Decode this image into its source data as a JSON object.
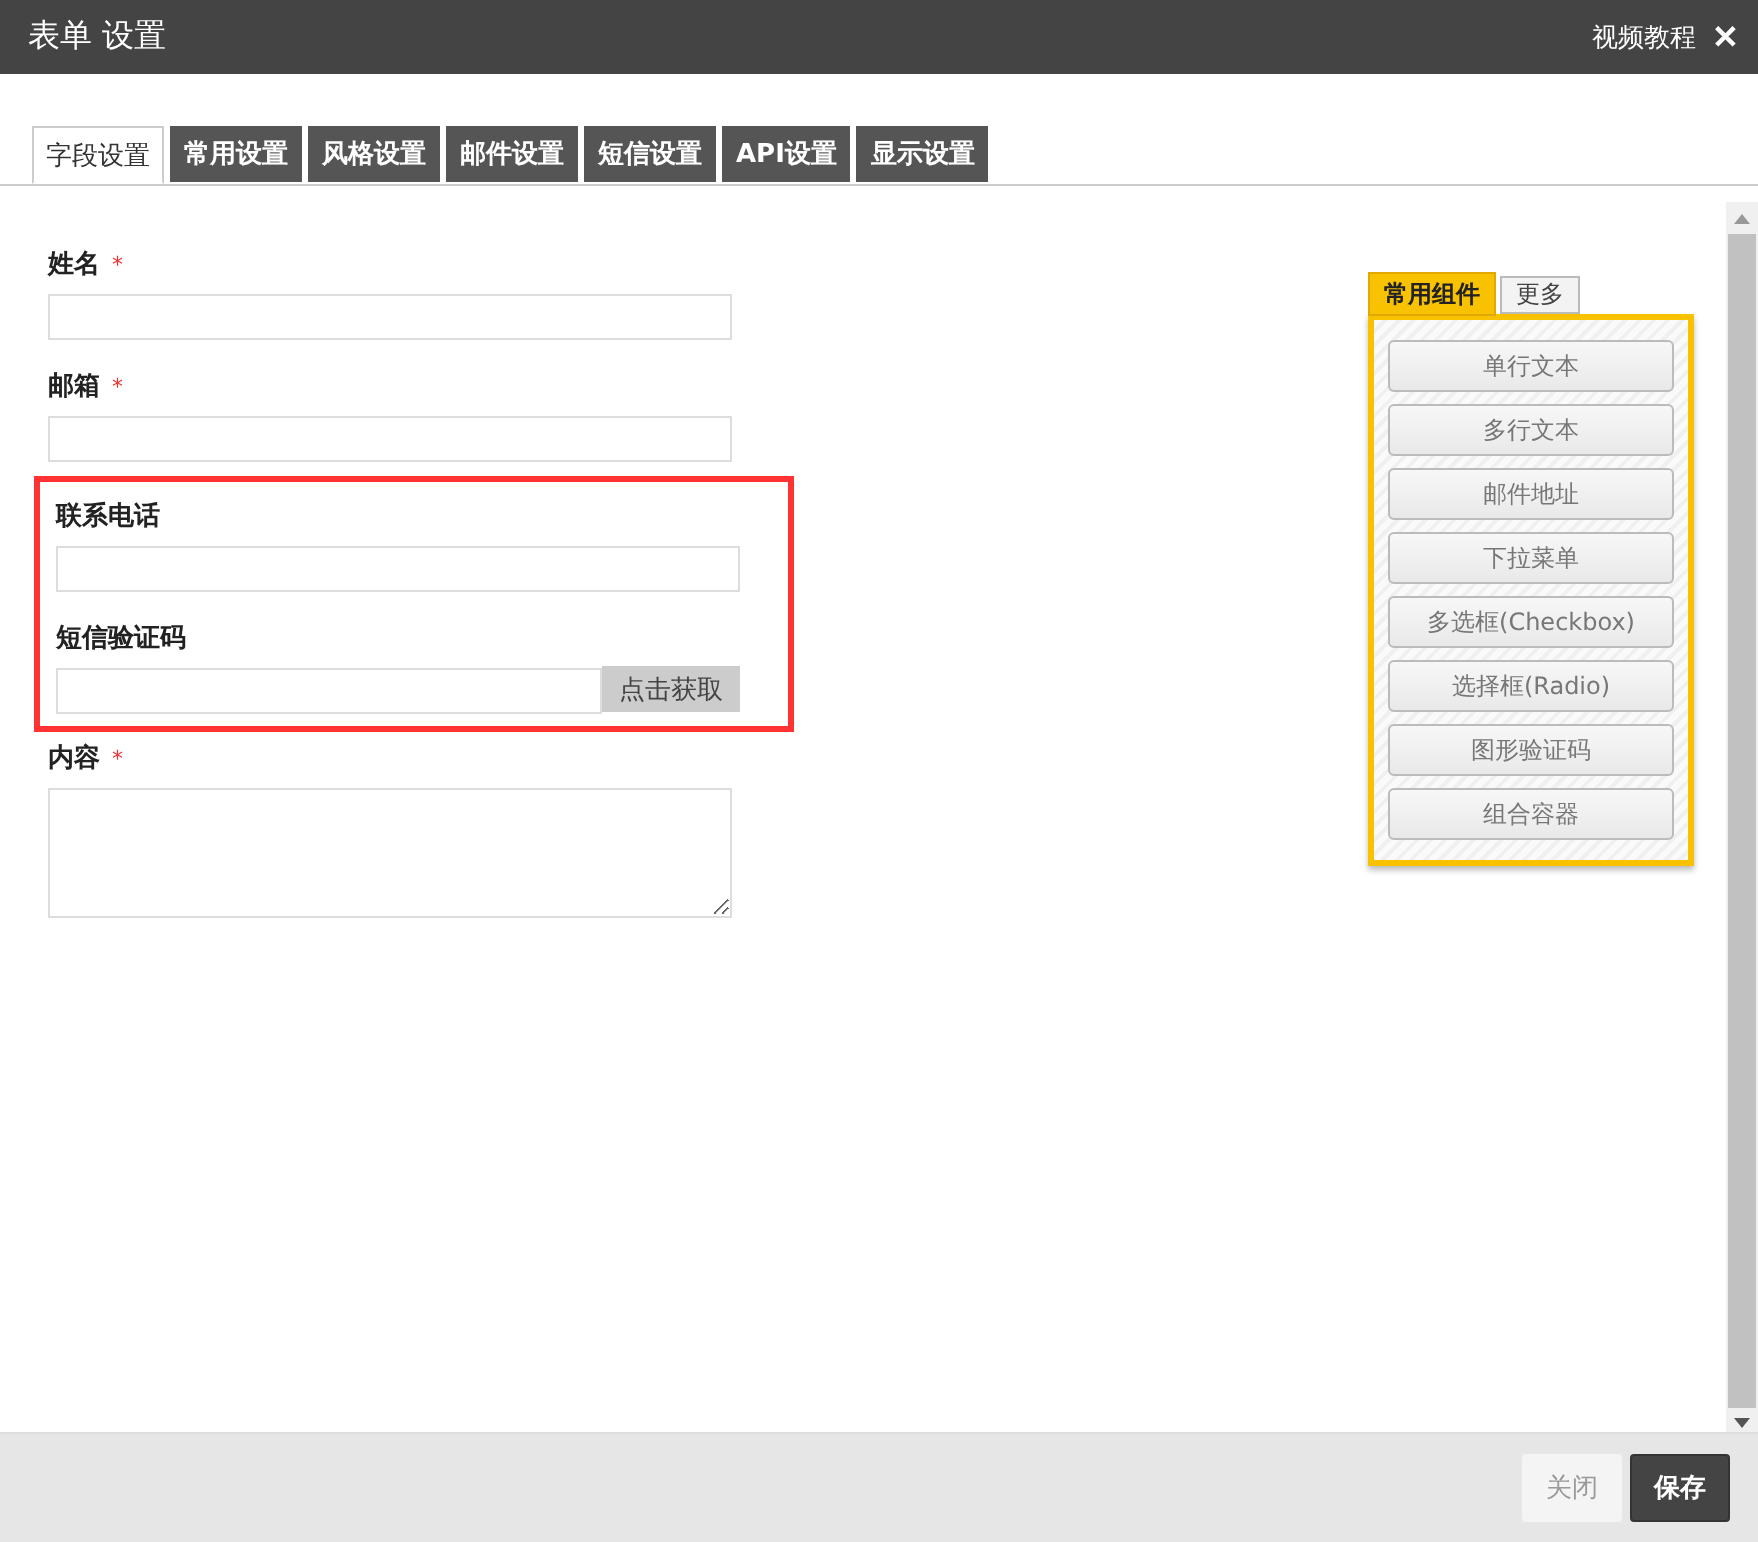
{
  "window": {
    "title": "表单 设置",
    "help_link": "视频教程",
    "close": "✕"
  },
  "tabs": [
    {
      "label": "字段设置",
      "selected": true
    },
    {
      "label": "常用设置",
      "selected": false
    },
    {
      "label": "风格设置",
      "selected": false
    },
    {
      "label": "邮件设置",
      "selected": false
    },
    {
      "label": "短信设置",
      "selected": false
    },
    {
      "label": "API设置",
      "selected": false
    },
    {
      "label": "显示设置",
      "selected": false
    }
  ],
  "fields": [
    {
      "kind": "text",
      "label": "姓名",
      "required": true
    },
    {
      "kind": "text",
      "label": "邮箱",
      "required": true
    },
    {
      "kind": "group",
      "children": [
        {
          "kind": "text",
          "label": "联系电话",
          "required": false
        },
        {
          "kind": "code",
          "label": "短信验证码",
          "required": false,
          "button": "点击获取"
        }
      ]
    },
    {
      "kind": "textarea",
      "label": "内容",
      "required": true
    }
  ],
  "required_mark": "*",
  "palette": {
    "tabs": [
      {
        "label": "常用组件",
        "selected": true
      },
      {
        "label": "更多",
        "selected": false
      }
    ],
    "items": [
      "单行文本",
      "多行文本",
      "邮件地址",
      "下拉菜单",
      "多选框(Checkbox)",
      "选择框(Radio)",
      "图形验证码",
      "组合容器"
    ]
  },
  "footer": {
    "buttons": [
      {
        "label": "关闭",
        "kind": "secondary"
      },
      {
        "label": "保存",
        "kind": "primary"
      }
    ]
  }
}
